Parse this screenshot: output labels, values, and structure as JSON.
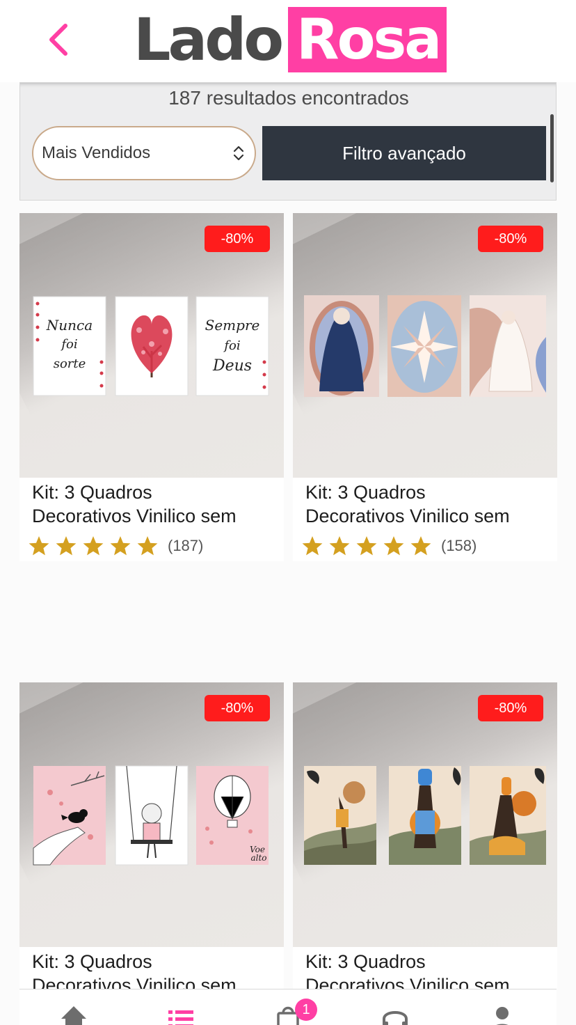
{
  "header": {
    "logo_part1": "Lado",
    "logo_part2": "Rosa",
    "back_icon": "chevron-left-icon",
    "brand_color": "#ff3fa4"
  },
  "results": {
    "count_text": "187 resultados encontrados",
    "sort_selected": "Mais Vendidos",
    "filter_label": "Filtro avançado"
  },
  "products": [
    {
      "discount": "-80%",
      "title_line1": "Kit: 3 Quadros",
      "title_line2": "Decorativos Vinilico sem",
      "stars": 5,
      "reviews": "(187)",
      "panel_text_left": [
        "Nunca",
        "foi",
        "sorte"
      ],
      "panel_text_right": [
        "Sempre",
        "foi",
        "Deus"
      ]
    },
    {
      "discount": "-80%",
      "title_line1": "Kit: 3 Quadros",
      "title_line2": "Decorativos Vinilico sem",
      "stars": 5,
      "reviews": "(158)"
    },
    {
      "discount": "-80%",
      "title_line1": "Kit: 3 Quadros",
      "title_line2": "Decorativos Vinilico sem",
      "panel_text_right": [
        "Voe",
        "alto"
      ]
    },
    {
      "discount": "-80%",
      "title_line1": "Kit: 3 Quadros",
      "title_line2": "Decorativos Vinilico sem"
    }
  ],
  "bottom_nav": {
    "items": [
      "home-icon",
      "list-icon",
      "shopping-bag-icon",
      "headset-icon",
      "user-icon"
    ],
    "active": "list-icon",
    "cart_count": "1"
  },
  "colors": {
    "badge_red": "#ff1c1c",
    "filter_button": "#2f3640",
    "star_gold": "#d4a020"
  }
}
